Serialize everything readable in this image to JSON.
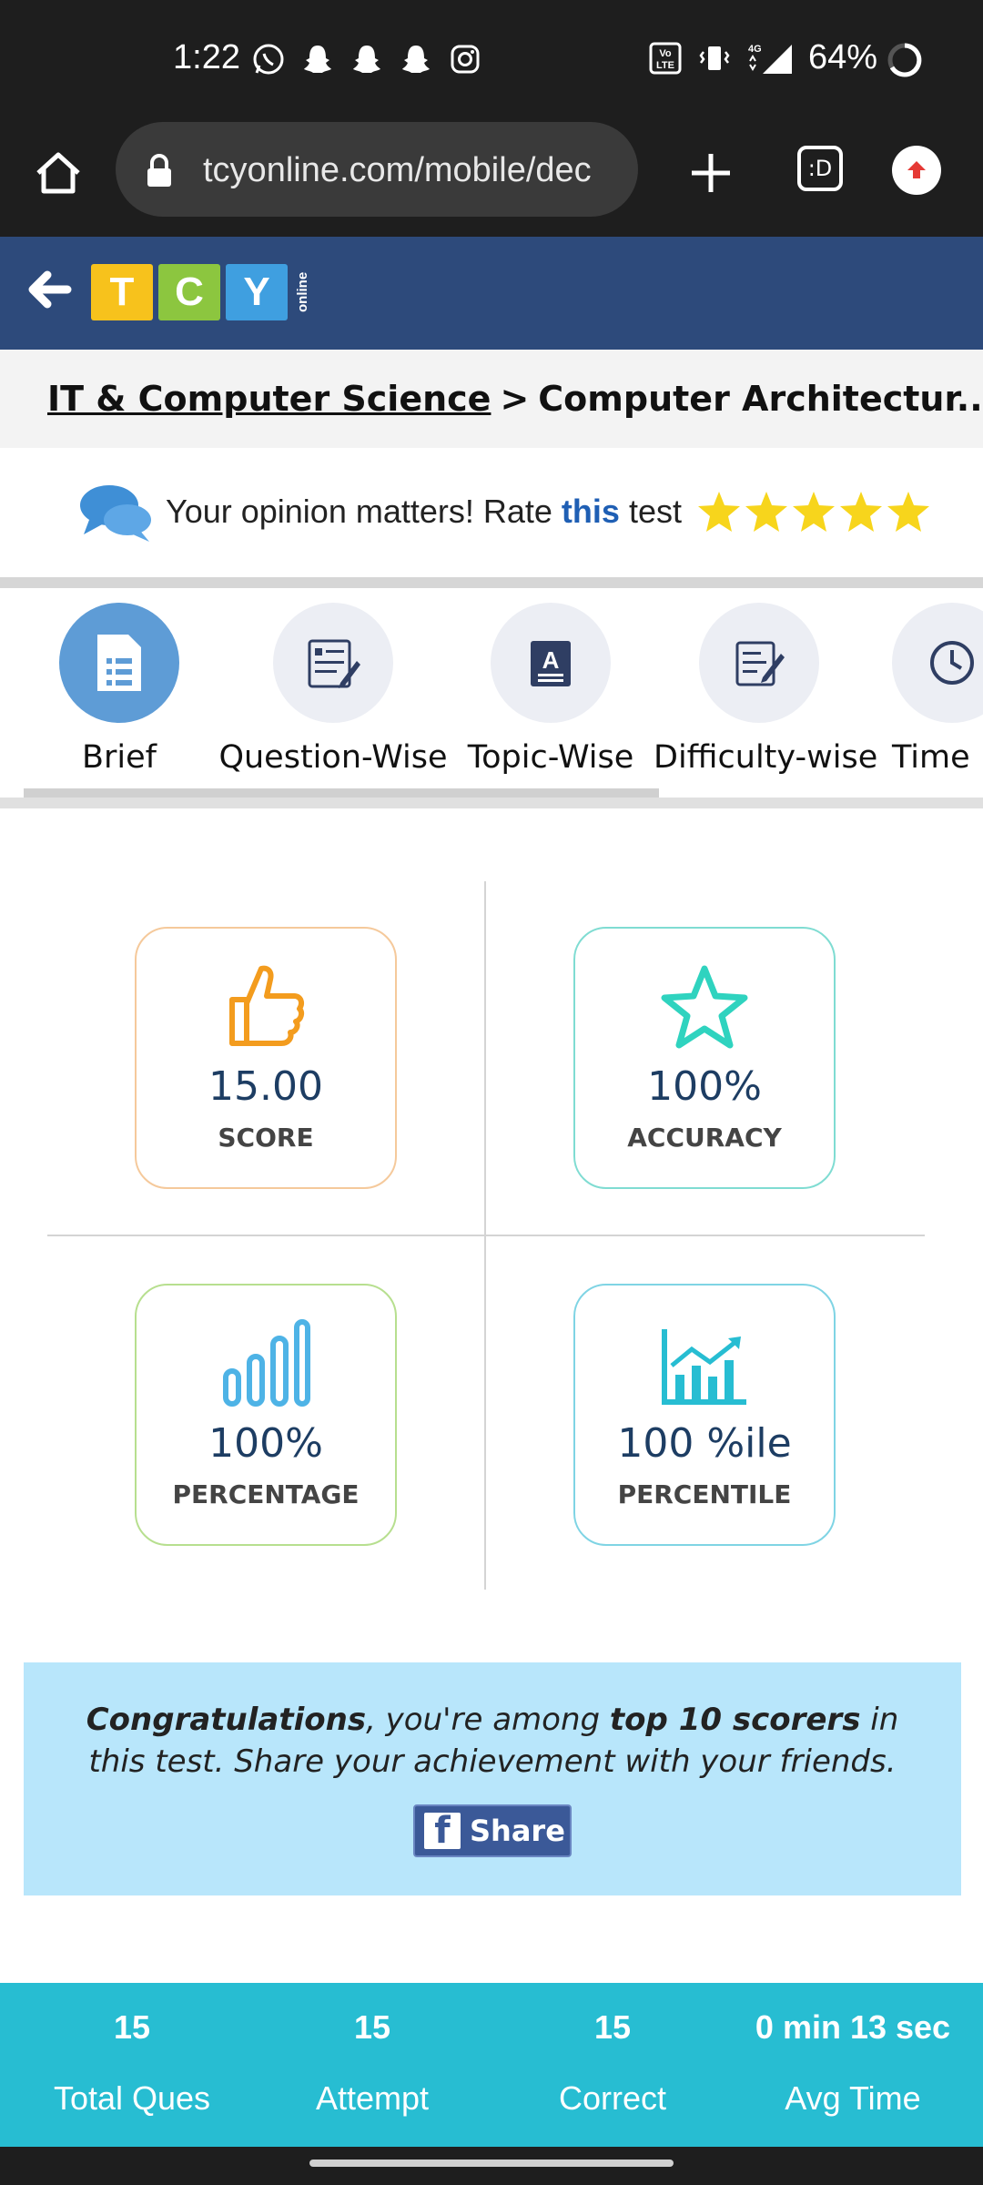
{
  "status_bar": {
    "time": "1:22",
    "battery": "64%",
    "left_icons": [
      "whatsapp-icon",
      "snapchat-icon",
      "snapchat-icon",
      "snapchat-icon",
      "instagram-icon"
    ],
    "right_icons": [
      "volte-icon",
      "vibrate-icon",
      "signal-4g-icon"
    ]
  },
  "browser": {
    "url": "tcyonline.com/mobile/dec",
    "tab_count": ":D"
  },
  "header": {
    "logo_letters": [
      "T",
      "C",
      "Y"
    ],
    "logo_suffix": "online"
  },
  "breadcrumb": {
    "parent": "IT & Computer Science ",
    "separator": ">",
    "current": "Computer Architectur..."
  },
  "opinion": {
    "text_before": "Your opinion matters! Rate",
    "link": "this",
    "text_after": "test",
    "stars": 5
  },
  "tabs": [
    {
      "label": "Brief",
      "active": true
    },
    {
      "label": "Question-Wise",
      "active": false
    },
    {
      "label": "Topic-Wise",
      "active": false
    },
    {
      "label": "Difficulty-wise",
      "active": false
    },
    {
      "label": "Time",
      "active": false
    }
  ],
  "stats": {
    "score": {
      "value": "15.00",
      "caption": "SCORE",
      "color": "#f5c99b"
    },
    "accuracy": {
      "value": "100%",
      "caption": "ACCURACY",
      "color": "#7fdcd2"
    },
    "percentage": {
      "value": "100%",
      "caption": "PERCENTAGE",
      "color": "#b7df8f"
    },
    "percentile": {
      "value": "100 %ile",
      "caption": "PERCENTILE",
      "color": "#7fd4e4"
    }
  },
  "congrats": {
    "lead": "Congratulations",
    "mid": ", you're among ",
    "highlight": "top 10 scorers",
    "tail": " in this test. Share your achievement with your friends.",
    "share_label": "Share"
  },
  "footer": [
    {
      "num": "15",
      "label": "Total Ques"
    },
    {
      "num": "15",
      "label": "Attempt"
    },
    {
      "num": "15",
      "label": "Correct"
    },
    {
      "num": "0 min 13 sec",
      "label": "Avg Time"
    }
  ],
  "colors": {
    "header_bg": "#2d4a7b",
    "tab_active": "#5e9cd6",
    "footer_bg": "#27bdd2",
    "congrats_bg": "#b8e6fb"
  }
}
